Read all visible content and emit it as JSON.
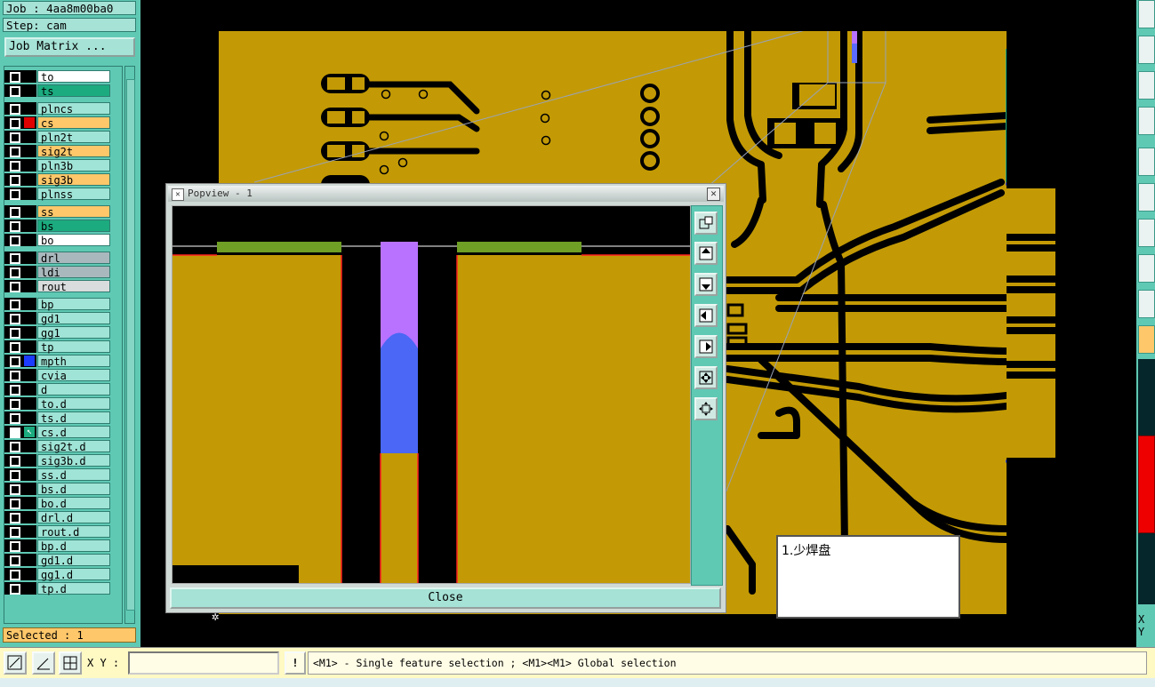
{
  "header": {
    "job": "Job : 4aa8m00ba0",
    "step": "Step: cam"
  },
  "job_matrix_button": "Job Matrix ...",
  "layers": [
    {
      "name": "to",
      "color": "#ffffff"
    },
    {
      "name": "ts",
      "color": "#1bab7f"
    },
    {
      "name": "plncs",
      "color": "#9fe4d6"
    },
    {
      "name": "cs",
      "color": "#fdc76a",
      "mark": "#e00000"
    },
    {
      "name": "pln2t",
      "color": "#9fe4d6"
    },
    {
      "name": "sig2t",
      "color": "#fdc76a"
    },
    {
      "name": "pln3b",
      "color": "#9fe4d6"
    },
    {
      "name": "sig3b",
      "color": "#fdc76a"
    },
    {
      "name": "plnss",
      "color": "#9fe4d6"
    },
    {
      "name": "ss",
      "color": "#fdc76a"
    },
    {
      "name": "bs",
      "color": "#1bab7f"
    },
    {
      "name": "bo",
      "color": "#ffffff"
    },
    {
      "name": "drl",
      "color": "#a9b8bd"
    },
    {
      "name": "ldi",
      "color": "#a9b8bd"
    },
    {
      "name": "rout",
      "color": "#d9dcdc"
    },
    {
      "name": "bp",
      "color": "#9fe4d6"
    },
    {
      "name": "gd1",
      "color": "#9fe4d6"
    },
    {
      "name": "gg1",
      "color": "#9fe4d6"
    },
    {
      "name": "tp",
      "color": "#9fe4d6"
    },
    {
      "name": "mpth",
      "color": "#9fe4d6",
      "mark": "#1c3cff"
    },
    {
      "name": "cvia",
      "color": "#9fe4d6"
    },
    {
      "name": "d",
      "color": "#9fe4d6"
    },
    {
      "name": "to.d",
      "color": "#9fe4d6"
    },
    {
      "name": "ts.d",
      "color": "#9fe4d6"
    },
    {
      "name": "cs.d",
      "color": "#9fe4d6",
      "selected": true,
      "arrow": true
    },
    {
      "name": "sig2t.d",
      "color": "#9fe4d6"
    },
    {
      "name": "sig3b.d",
      "color": "#9fe4d6"
    },
    {
      "name": "ss.d",
      "color": "#9fe4d6"
    },
    {
      "name": "bs.d",
      "color": "#9fe4d6"
    },
    {
      "name": "bo.d",
      "color": "#9fe4d6"
    },
    {
      "name": "drl.d",
      "color": "#9fe4d6"
    },
    {
      "name": "rout.d",
      "color": "#9fe4d6"
    },
    {
      "name": "bp.d",
      "color": "#9fe4d6"
    },
    {
      "name": "gd1.d",
      "color": "#9fe4d6"
    },
    {
      "name": "gg1.d",
      "color": "#9fe4d6"
    },
    {
      "name": "tp.d",
      "color": "#9fe4d6"
    }
  ],
  "status": {
    "selected": "Selected : 1"
  },
  "popview": {
    "title": "Popview - 1",
    "close_label": "Close"
  },
  "note": {
    "text": "1.少焊盘"
  },
  "bottom": {
    "xy_label": "X Y :",
    "xy_value": "",
    "message": "<M1> - Single feature selection ; <M1><M1> Global selection"
  },
  "right": {
    "xy_label": "X\nY"
  },
  "colors": {
    "copper": "#c39a05",
    "panel": "#5fc9b4",
    "highlight": "#fdc76a"
  }
}
